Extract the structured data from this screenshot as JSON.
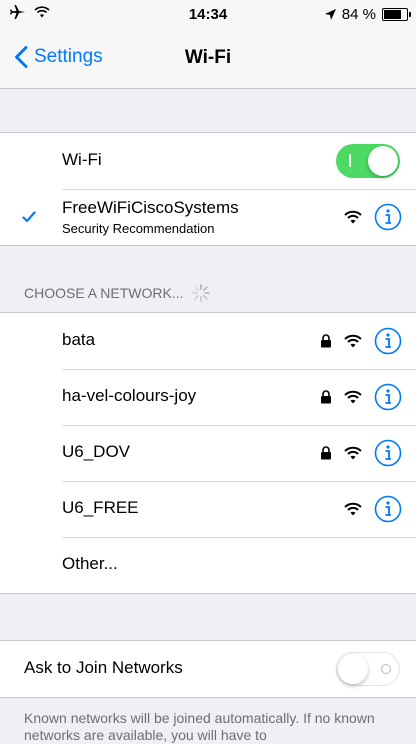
{
  "status_bar": {
    "time": "14:34",
    "battery_text": "84 %",
    "battery_level": 0.84,
    "icons": [
      "airplane-icon",
      "wifi-icon",
      "location-arrow-icon",
      "battery-icon"
    ]
  },
  "nav": {
    "back_label": "Settings",
    "title": "Wi-Fi"
  },
  "wifi_toggle": {
    "label": "Wi-Fi",
    "on": true
  },
  "connected_network": {
    "name": "FreeWiFiCiscoSystems",
    "subtitle": "Security Recommendation",
    "secured": false
  },
  "choose_network": {
    "header": "CHOOSE A NETWORK...",
    "networks": [
      {
        "name": "bata",
        "secured": true
      },
      {
        "name": "ha-vel-colours-joy",
        "secured": true
      },
      {
        "name": "U6_DOV",
        "secured": true
      },
      {
        "name": "U6_FREE",
        "secured": false
      }
    ],
    "other_label": "Other..."
  },
  "ask_to_join": {
    "label": "Ask to Join Networks",
    "on": false
  },
  "footer": {
    "text": "Known networks will be joined automatically. If no known networks are available, you will have to"
  },
  "colors": {
    "accent": "#007aff",
    "toggle_on": "#4cd964",
    "background": "#efeff4"
  }
}
